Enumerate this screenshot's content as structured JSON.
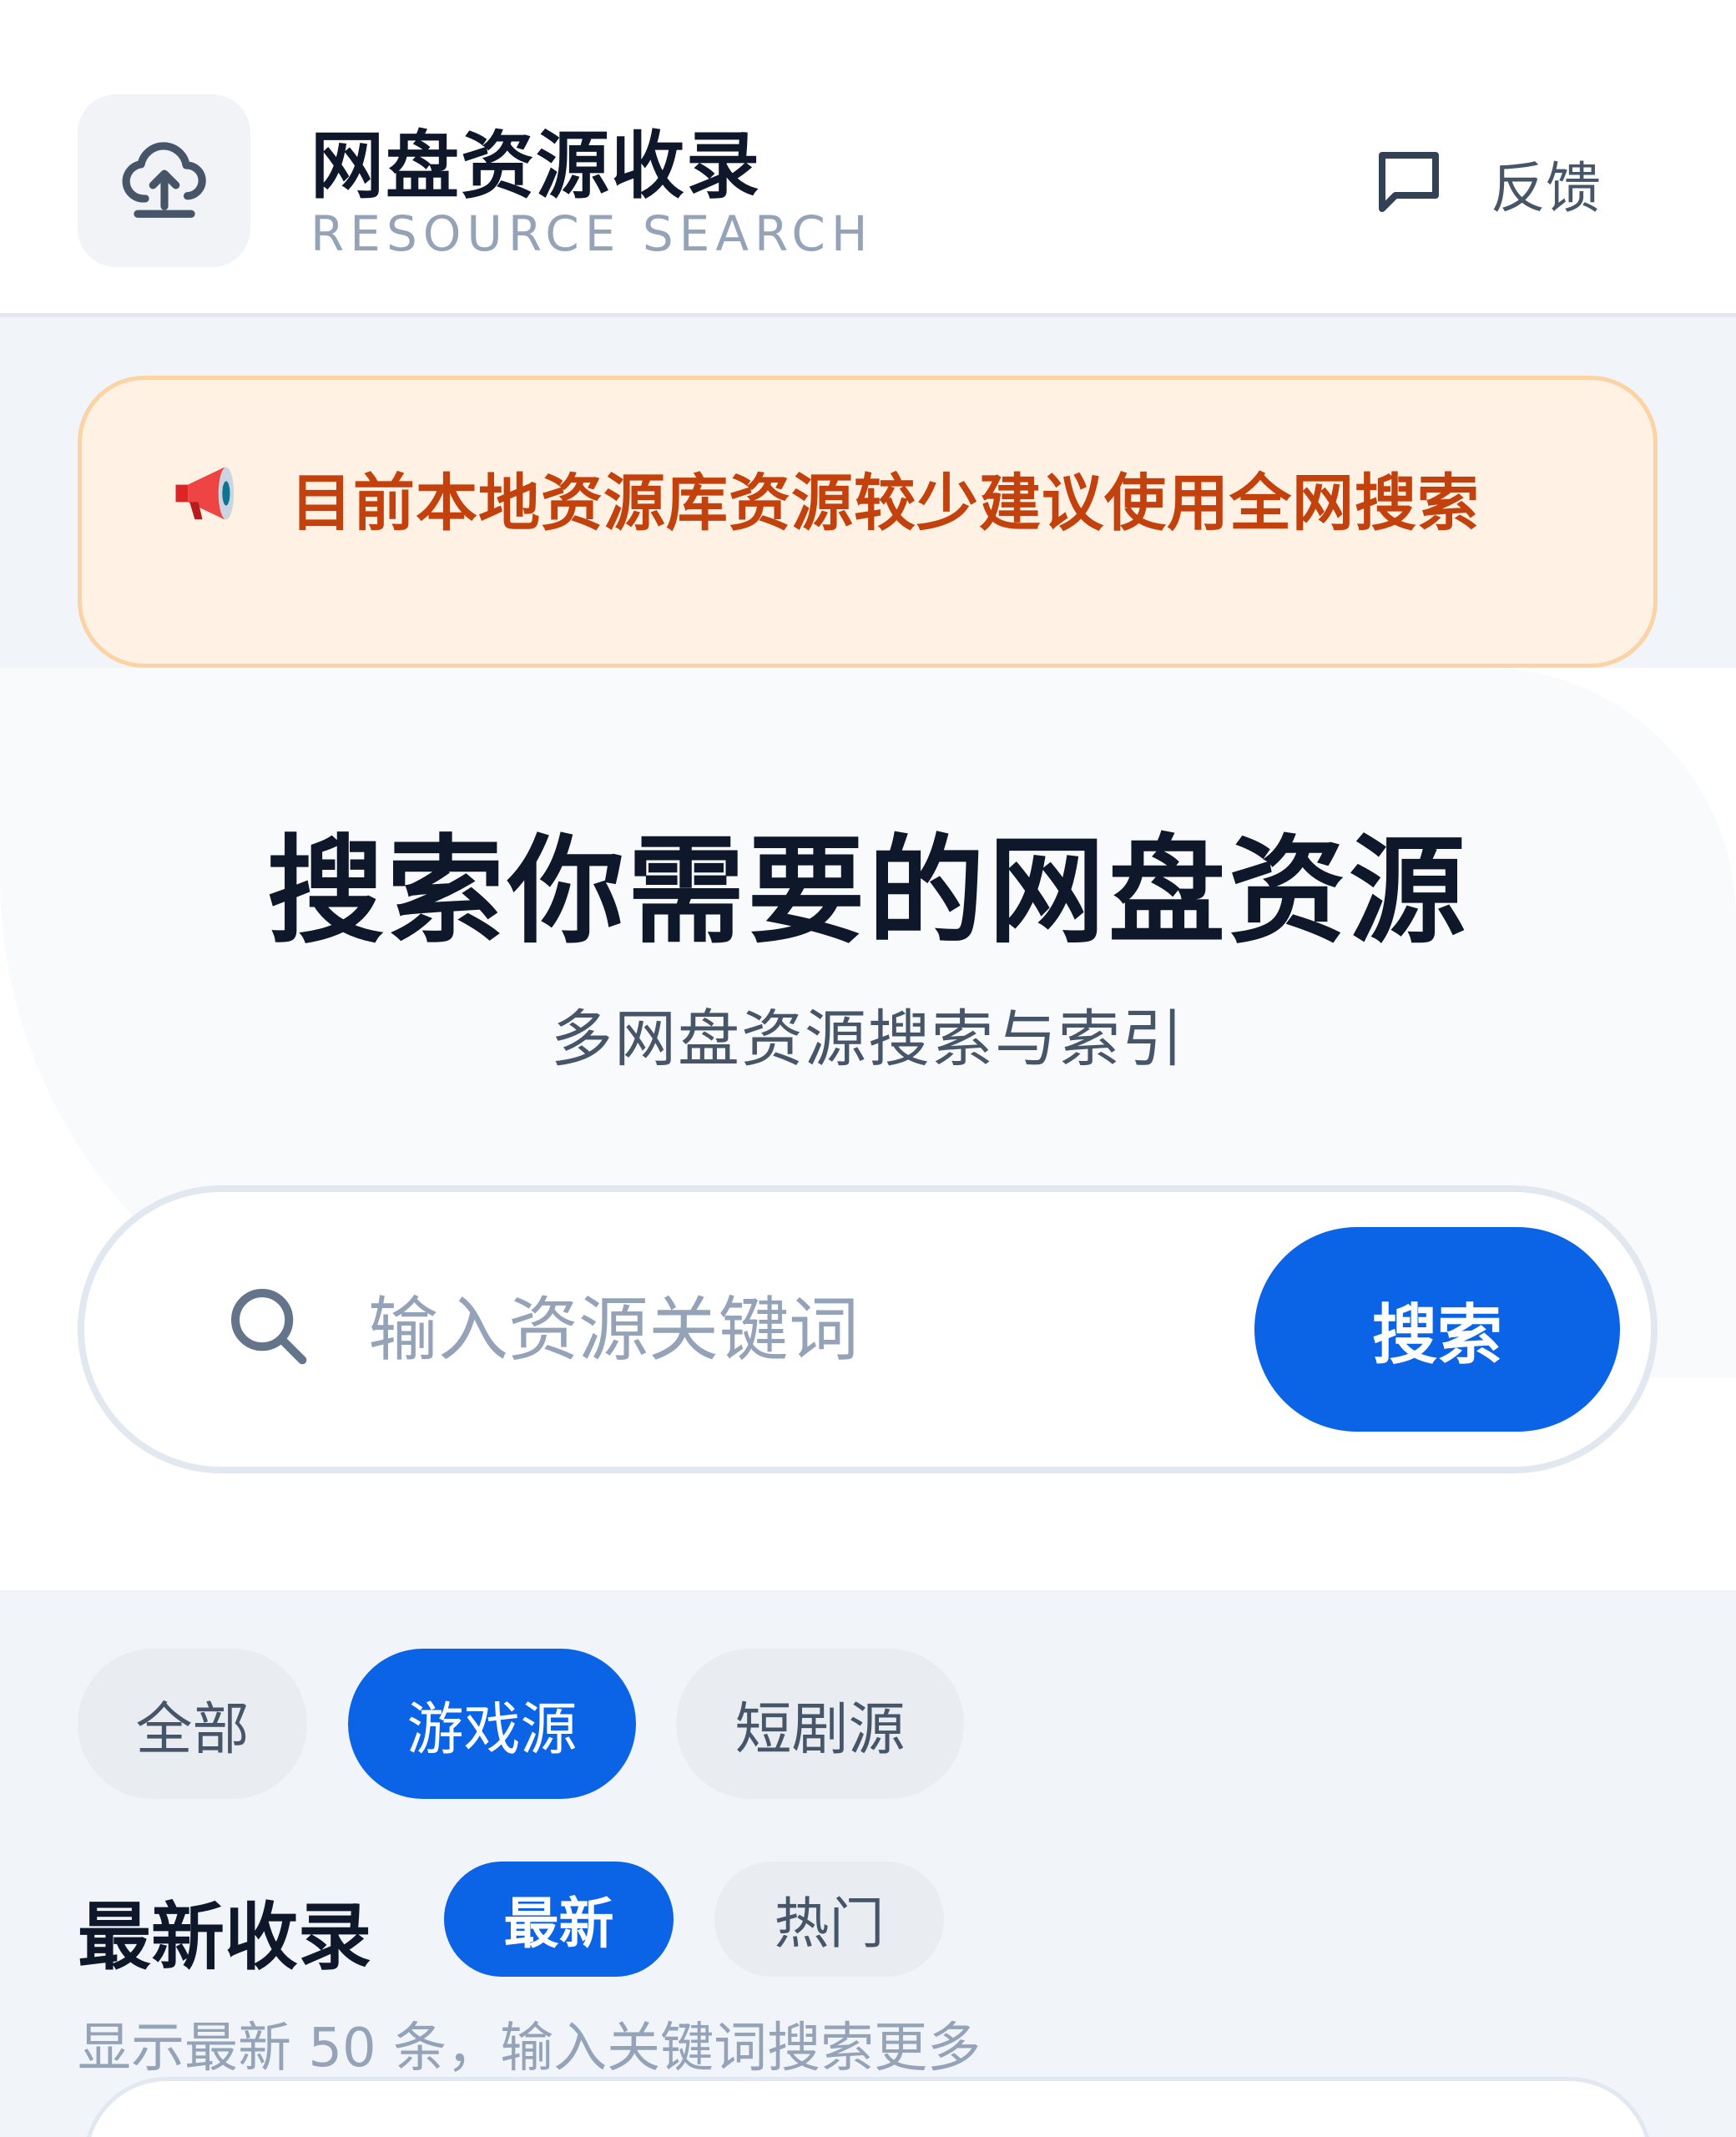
{
  "header": {
    "title": "网盘资源收录",
    "subtitle": "RESOURCE SEARCH",
    "logo_icon": "cloud-upload-icon",
    "feedback_icon": "message-square-icon",
    "feedback_label": "反馈"
  },
  "notice": {
    "icon": "megaphone-icon",
    "text": "目前本地资源库资源较少建议使用全网搜索"
  },
  "hero": {
    "title": "搜索你需要的网盘资源",
    "subtitle": "多网盘资源搜索与索引"
  },
  "search": {
    "icon": "search-icon",
    "placeholder": "输入资源关键词",
    "value": "",
    "button_label": "搜索"
  },
  "categories": {
    "items": [
      {
        "label": "全部",
        "active": false
      },
      {
        "label": "游戏源",
        "active": true
      },
      {
        "label": "短剧源",
        "active": false
      }
    ]
  },
  "section": {
    "title": "最新收录",
    "sort_tabs": [
      {
        "label": "最新",
        "active": true
      },
      {
        "label": "热门",
        "active": false
      }
    ],
    "hint": "显示最新 50 条，输入关键词搜索更多"
  },
  "colors": {
    "accent": "#0b63e5",
    "notice_text": "#c2410c",
    "notice_bg": "#fff1e4"
  }
}
